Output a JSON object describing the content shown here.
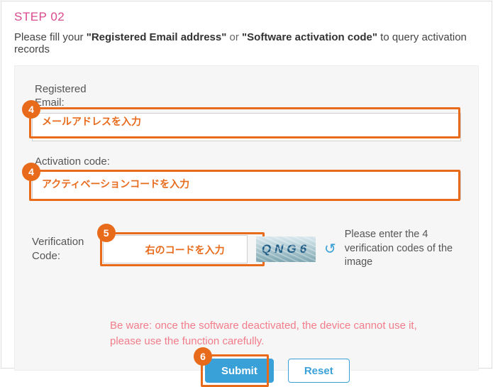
{
  "step_title": "STEP 02",
  "instruction": {
    "prefix": "Please fill your ",
    "bold1": "\"Registered Email address\"",
    "or": " or ",
    "bold2": "\"Software activation code\"",
    "suffix": " to query activation records"
  },
  "email": {
    "label": "Registered Email:",
    "placeholder": "",
    "annotation": "メールアドレスを入力"
  },
  "code": {
    "label": "Activation code:",
    "placeholder": "",
    "annotation": "アクティベーションコードを入力"
  },
  "captcha": {
    "label": "Verification Code:",
    "annotation": "右のコードを入力",
    "image_text": "QNG6",
    "hint": "Please enter the 4 verification codes of the image"
  },
  "warning": "Be ware: once the software deactivated, the device cannot use it, please use the function carefully.",
  "buttons": {
    "submit": "Submit",
    "reset": "Reset"
  },
  "badges": {
    "b4a": "4",
    "b4b": "4",
    "b5": "5",
    "b6": "6"
  }
}
